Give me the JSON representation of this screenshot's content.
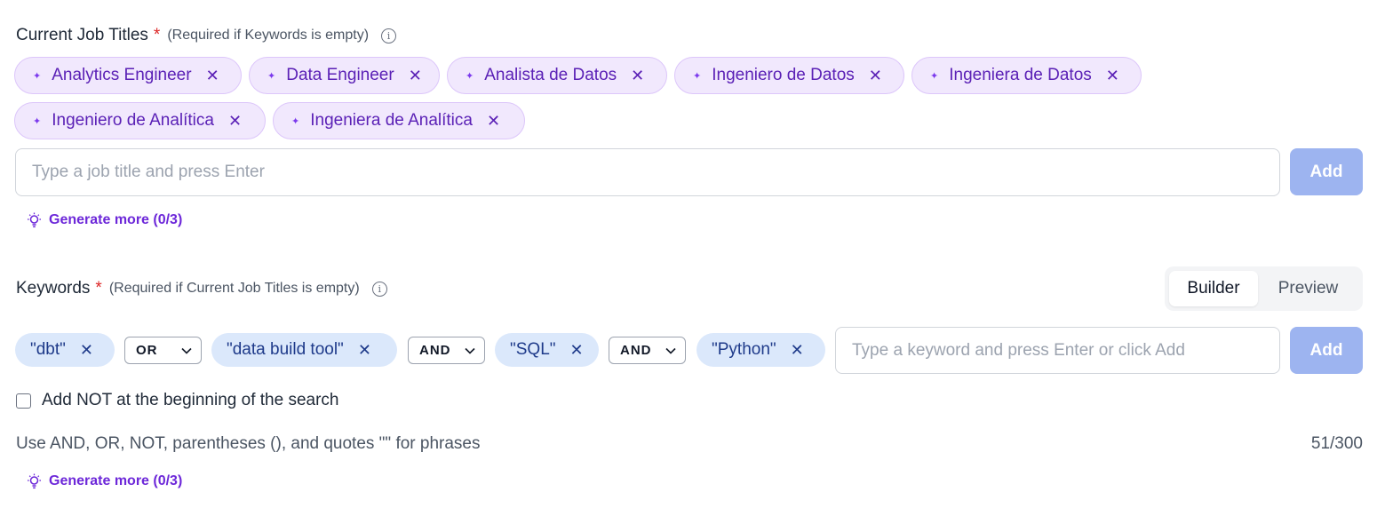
{
  "job_titles": {
    "label": "Current Job Titles",
    "required_mark": "*",
    "hint": "(Required if Keywords is empty)",
    "chips": [
      {
        "label": "Analytics Engineer"
      },
      {
        "label": "Data Engineer"
      },
      {
        "label": "Analista de Datos"
      },
      {
        "label": "Ingeniero de Datos"
      },
      {
        "label": "Ingeniera de Datos"
      },
      {
        "label": "Ingeniero de Analítica"
      },
      {
        "label": "Ingeniera de Analítica"
      }
    ],
    "input_placeholder": "Type a job title and press Enter",
    "add_label": "Add",
    "generate_label": "Generate more (0/3)"
  },
  "keywords": {
    "label": "Keywords",
    "required_mark": "*",
    "hint": "(Required if Current Job Titles is empty)",
    "view_toggle": {
      "builder": "Builder",
      "preview": "Preview",
      "selected": "Builder"
    },
    "terms": [
      "\"dbt\"",
      "\"data build tool\"",
      "\"SQL\"",
      "\"Python\""
    ],
    "operators": [
      "OR",
      "AND",
      "AND"
    ],
    "input_placeholder": "Type a keyword and press Enter or click Add",
    "add_label": "Add",
    "not_checkbox_label": "Add NOT at the beginning of the search",
    "not_checked": false,
    "help_text": "Use AND, OR, NOT, parentheses (), and quotes \"\" for phrases",
    "char_count": "51/300",
    "generate_label": "Generate more (0/3)"
  },
  "icons": {
    "info": "info-icon",
    "sparkle": "sparkle-icon",
    "remove": "close-icon",
    "bulb": "lightbulb-icon",
    "chevron": "chevron-down-icon"
  },
  "colors": {
    "title_chip_bg": "#f1e8fd",
    "title_chip_text": "#5b21b6",
    "keyword_chip_bg": "#dbe8fb",
    "keyword_chip_text": "#1e3a8a",
    "add_button": "#9db4f0",
    "required": "#dc2626",
    "generate_link": "#6d28d9"
  }
}
